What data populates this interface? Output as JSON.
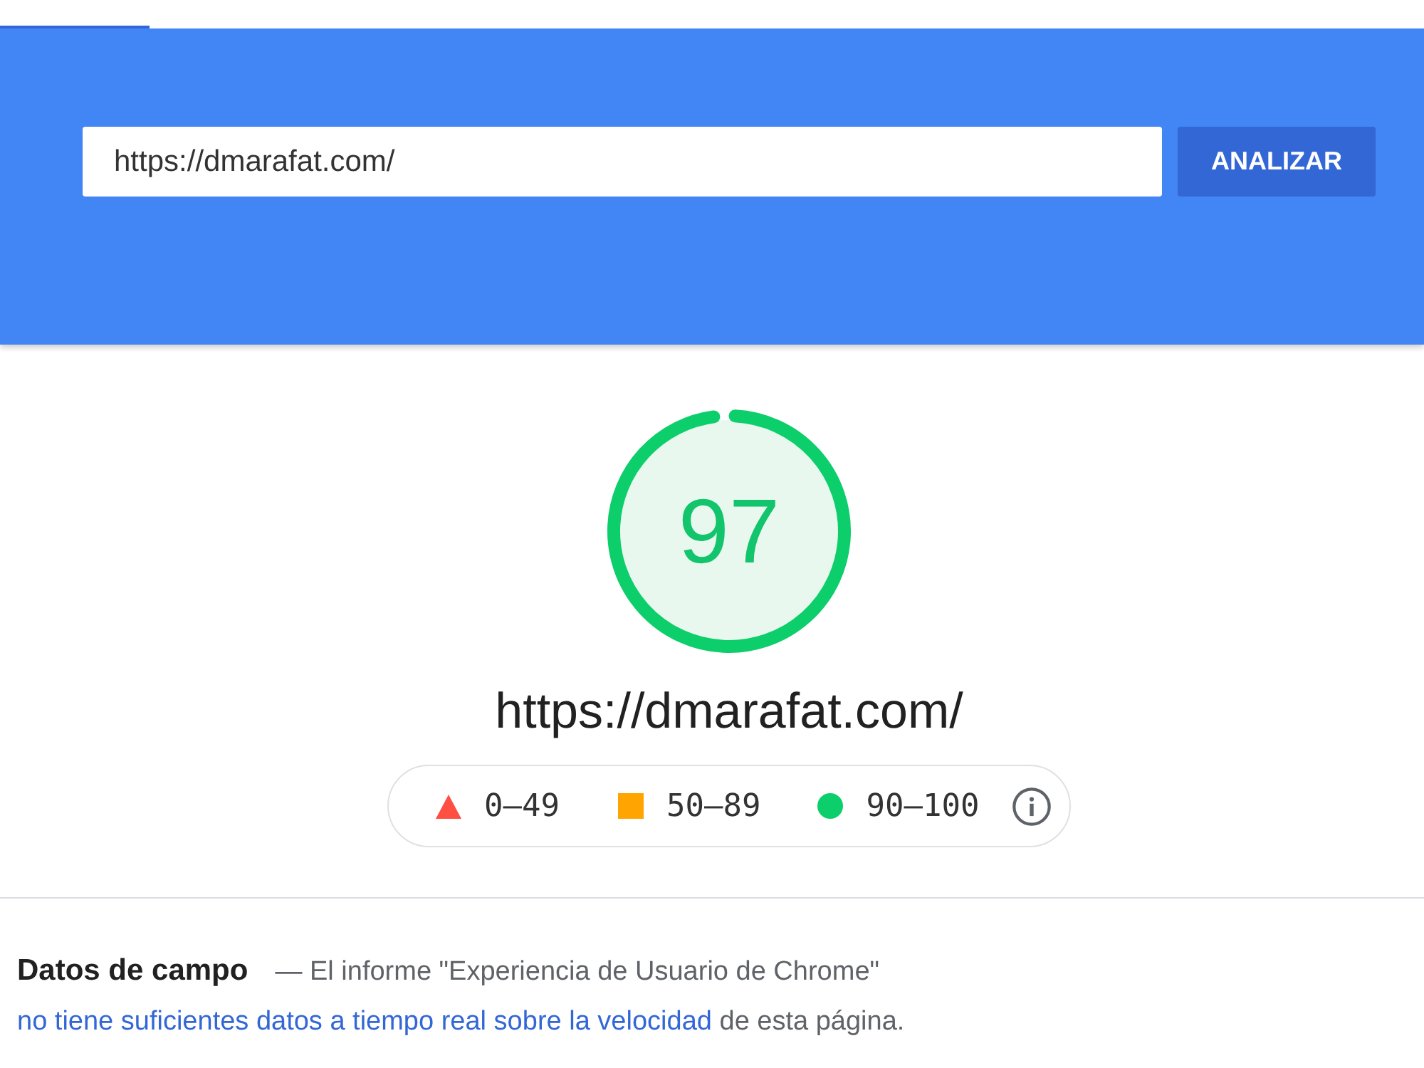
{
  "header": {
    "url_field": {
      "value": "https://dmarafat.com/"
    },
    "analyze_button": "ANALIZAR"
  },
  "score": {
    "value": "97",
    "level": 0.97,
    "url": "https://dmarafat.com/"
  },
  "legend": [
    {
      "kind": "triangle",
      "label": "0–49",
      "color": "#ff4e42"
    },
    {
      "kind": "square",
      "label": "50–89",
      "color": "#ffa400"
    },
    {
      "kind": "circle",
      "label": "90–100",
      "color": "#0cce6b"
    }
  ],
  "field_data": {
    "heading": "Datos de campo",
    "text": "— El informe \"Experiencia de Usuario de Chrome\"",
    "link": "no tiene suficientes datos a tiempo real sobre la velocidad",
    "text_after": "de esta página."
  }
}
